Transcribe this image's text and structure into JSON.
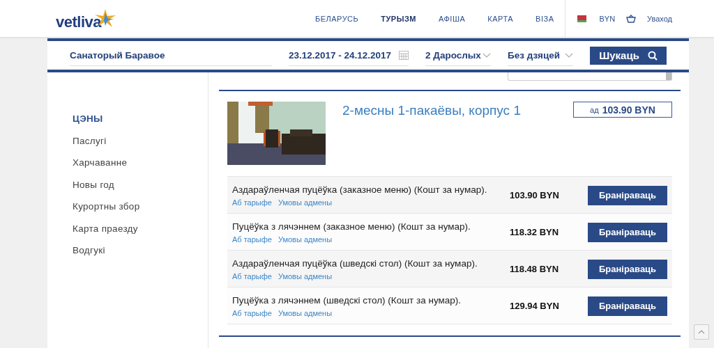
{
  "header": {
    "logo": "vetliva",
    "nav": [
      {
        "label": "БЕЛАРУСЬ",
        "selected": false
      },
      {
        "label": "ТУРЫЗМ",
        "selected": true
      },
      {
        "label": "АФІША",
        "selected": false
      },
      {
        "label": "КАРТА",
        "selected": false
      },
      {
        "label": "ВІЗА",
        "selected": false
      }
    ],
    "currency": "BYN",
    "login": "Уваход"
  },
  "search": {
    "place": "Санаторый Баравое",
    "dates": "23.12.2017 - 24.12.2017",
    "adults": "2 Дарослых",
    "children": "Без дзяцей",
    "button": "Шукаць"
  },
  "sidebar": {
    "items": [
      {
        "label": "ЦЭНЫ",
        "selected": true
      },
      {
        "label": "Паслугі",
        "selected": false
      },
      {
        "label": "Харчаванне",
        "selected": false
      },
      {
        "label": "Новы год",
        "selected": false
      },
      {
        "label": "Курортны збор",
        "selected": false
      },
      {
        "label": "Карта праезду",
        "selected": false
      },
      {
        "label": "Водгукі",
        "selected": false
      }
    ]
  },
  "room": {
    "title": "2-месны 1-пакаёвы, корпус 1",
    "price_prefix": "ад",
    "price": "103.90 BYN",
    "tariffs": [
      {
        "name": "Аздараўленчая пуцёўка (заказное меню) (Кошт за нумар).",
        "links": [
          "Аб тарыфе",
          "Умовы адмены"
        ],
        "price": "103.90 BYN",
        "button": "Браніраваць"
      },
      {
        "name": "Пуцёўка з лячэннем (заказное меню) (Кошт за нумар).",
        "links": [
          "Аб тарыфе",
          "Умовы адмены"
        ],
        "price": "118.32 BYN",
        "button": "Браніраваць"
      },
      {
        "name": "Аздараўленчая пуцёўка (шведскі стол) (Кошт за нумар).",
        "links": [
          "Аб тарыфе",
          "Умовы адмены"
        ],
        "price": "118.48 BYN",
        "button": "Браніраваць"
      },
      {
        "name": "Пуцёўка з лячэннем (шведскі стол) (Кошт за нумар).",
        "links": [
          "Аб тарыфе",
          "Умовы адмены"
        ],
        "price": "129.94 BYN",
        "button": "Браніраваць"
      }
    ]
  }
}
